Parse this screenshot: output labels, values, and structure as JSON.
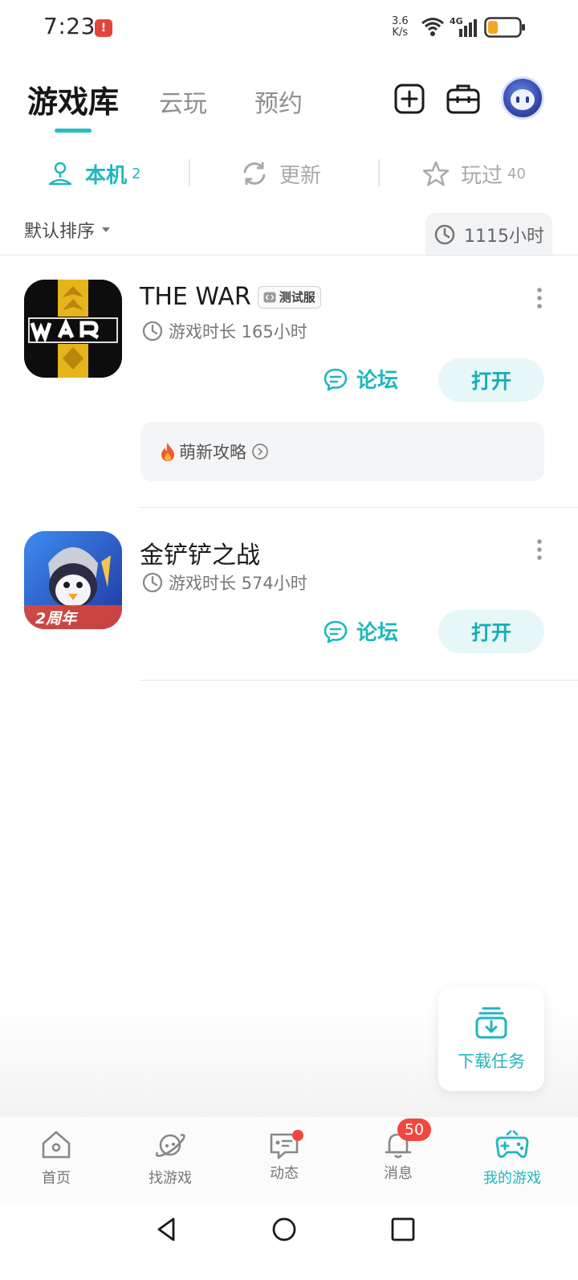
{
  "status_bar": {
    "time": "7:23",
    "notif_icon": "!",
    "net_speed_value": "3.6",
    "net_speed_unit": "K/s",
    "network": "4G"
  },
  "top_tabs": {
    "library": "游戏库",
    "cloud": "云玩",
    "reserve": "预约"
  },
  "sub_tabs": {
    "local_label": "本机",
    "local_count": "2",
    "update_label": "更新",
    "played_label": "玩过",
    "played_count": "40"
  },
  "sort": {
    "label": "默认排序"
  },
  "total_hours": "1115小时",
  "games": [
    {
      "title": "THE WAR",
      "badge": "测试服",
      "playtime": "游戏时长 165小时",
      "forum_label": "论坛",
      "open_label": "打开",
      "tip": "萌新攻略"
    },
    {
      "title": "金铲铲之战",
      "playtime": "游戏时长 574小时",
      "forum_label": "论坛",
      "open_label": "打开",
      "icon_tag": "2周年"
    }
  ],
  "download_task": "下载任务",
  "bottom_nav": {
    "home": "首页",
    "find": "找游戏",
    "feed": "动态",
    "messages": "消息",
    "messages_badge": "50",
    "my_games": "我的游戏"
  },
  "colors": {
    "accent": "#1fb7bd",
    "badge_red": "#f0483e"
  }
}
